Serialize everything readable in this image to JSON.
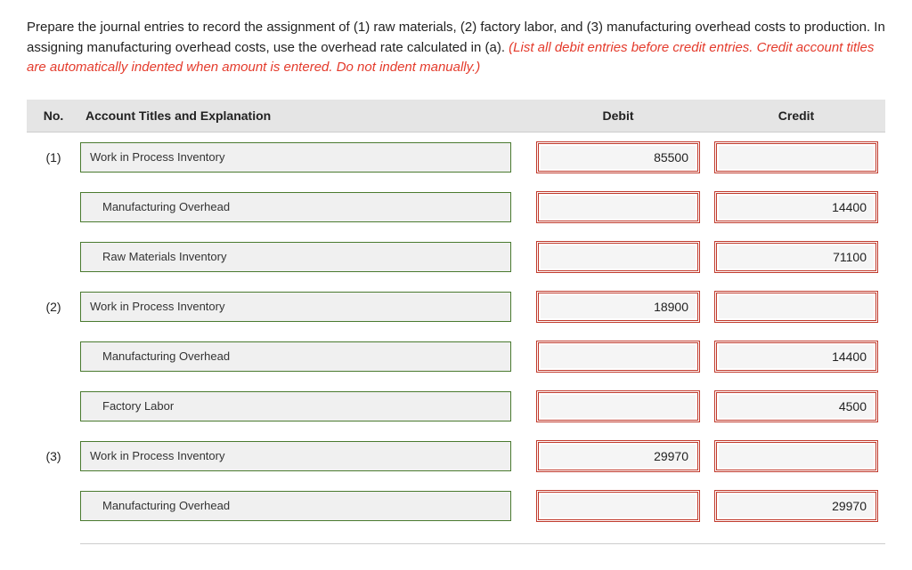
{
  "instructions": {
    "main": "Prepare the journal entries to record the assignment of (1) raw materials, (2) factory labor, and (3) manufacturing overhead costs to production. In assigning manufacturing overhead costs, use the overhead rate calculated in (a). ",
    "highlight": "(List all debit entries before credit entries. Credit account titles are automatically indented when amount is entered. Do not indent manually.)"
  },
  "headers": {
    "no": "No.",
    "title": "Account Titles and Explanation",
    "debit": "Debit",
    "credit": "Credit"
  },
  "rows": [
    {
      "no": "(1)",
      "title": "Work in Process Inventory",
      "indent": false,
      "debit": "85500",
      "credit": ""
    },
    {
      "no": "",
      "title": "Manufacturing Overhead",
      "indent": true,
      "debit": "",
      "credit": "14400"
    },
    {
      "no": "",
      "title": "Raw Materials Inventory",
      "indent": true,
      "debit": "",
      "credit": "71100"
    },
    {
      "no": "(2)",
      "title": "Work in Process Inventory",
      "indent": false,
      "debit": "18900",
      "credit": ""
    },
    {
      "no": "",
      "title": "Manufacturing Overhead",
      "indent": true,
      "debit": "",
      "credit": "14400"
    },
    {
      "no": "",
      "title": "Factory Labor",
      "indent": true,
      "debit": "",
      "credit": "4500"
    },
    {
      "no": "(3)",
      "title": "Work in Process Inventory",
      "indent": false,
      "debit": "29970",
      "credit": ""
    },
    {
      "no": "",
      "title": "Manufacturing Overhead",
      "indent": true,
      "debit": "",
      "credit": "29970"
    }
  ]
}
